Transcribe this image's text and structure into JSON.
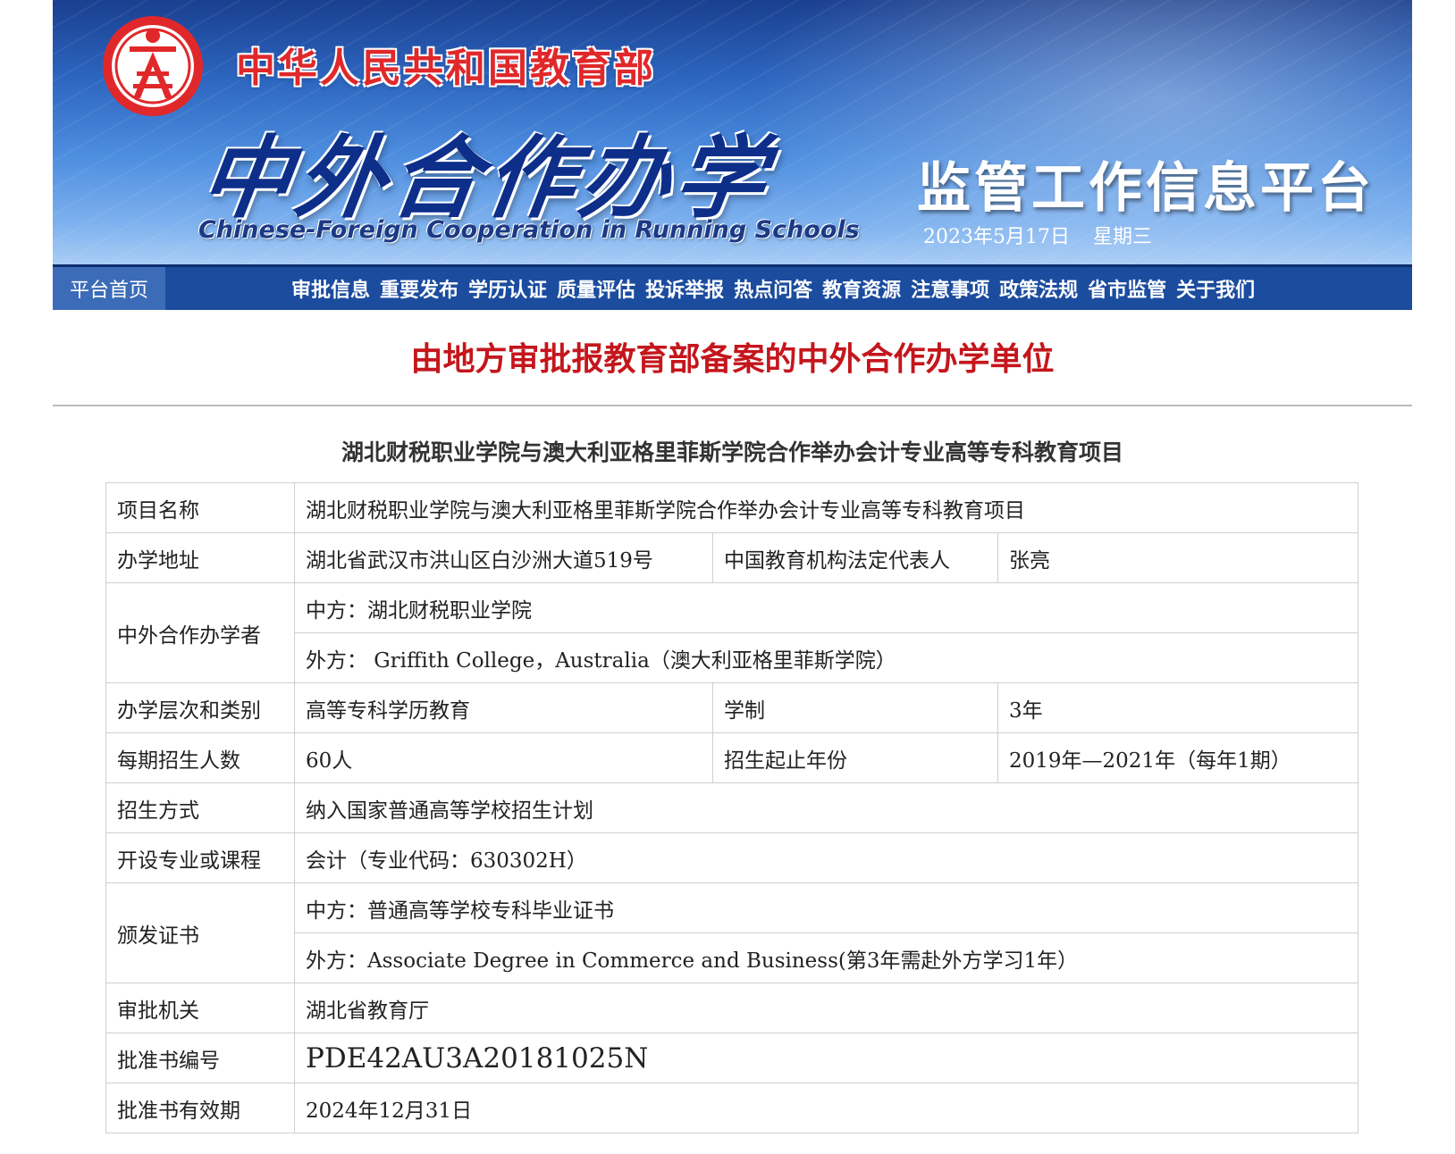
{
  "header": {
    "ministry": "中华人民共和国教育部",
    "title_cn": "中外合作办学",
    "title_en": "Chinese-Foreign Cooperation in Running Schools",
    "platform": "监管工作信息平台",
    "date": "2023年5月17日",
    "weekday": "星期三"
  },
  "nav": {
    "home": "平台首页",
    "items": [
      "审批信息",
      "重要发布",
      "学历认证",
      "质量评估",
      "投诉举报",
      "热点问答",
      "教育资源",
      "注意事项",
      "政策法规",
      "省市监管",
      "关于我们"
    ]
  },
  "page_title": "由地方审批报教育部备案的中外合作办学单位",
  "project_title": "湖北财税职业学院与澳大利亚格里菲斯学院合作举办会计专业高等专科教育项目",
  "table": {
    "name_label": "项目名称",
    "name_value": "湖北财税职业学院与澳大利亚格里菲斯学院合作举办会计专业高等专科教育项目",
    "address_label": "办学地址",
    "address_value": "湖北省武汉市洪山区白沙洲大道519号",
    "rep_label": "中国教育机构法定代表人",
    "rep_value": "张亮",
    "partners_label": "中外合作办学者",
    "partner_cn": "中方：湖北财税职业学院",
    "partner_foreign": "外方： Griffith College，Australia（澳大利亚格里菲斯学院）",
    "level_label": "办学层次和类别",
    "level_value": "高等专科学历教育",
    "duration_label": "学制",
    "duration_value": "3年",
    "enroll_label": "每期招生人数",
    "enroll_value": "60人",
    "years_label": "招生起止年份",
    "years_value": "2019年—2021年（每年1期）",
    "method_label": "招生方式",
    "method_value": "纳入国家普通高等学校招生计划",
    "course_label": "开设专业或课程",
    "course_value": "会计（专业代码：630302H）",
    "cert_label": "颁发证书",
    "cert_cn": "中方：普通高等学校专科毕业证书",
    "cert_foreign": "外方：Associate Degree in Commerce and Business(第3年需赴外方学习1年）",
    "authority_label": "审批机关",
    "authority_value": "湖北省教育厅",
    "approval_label": "批准书编号",
    "approval_value": "PDE42AU3A20181025N",
    "validity_label": "批准书有效期",
    "validity_value": "2024年12月31日"
  },
  "colors": {
    "banner_blue": "#2d66c0",
    "nav_blue": "#1b4c9e",
    "heading_red": "#c4161c"
  }
}
